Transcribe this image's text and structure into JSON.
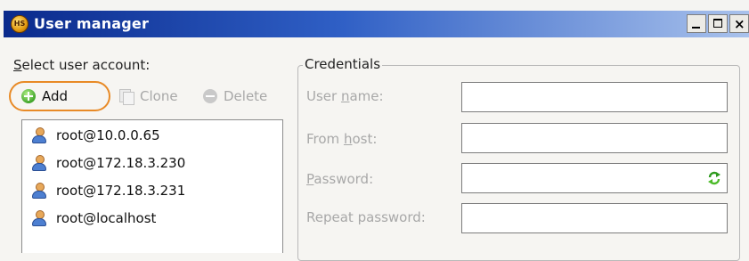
{
  "window": {
    "title": "User manager",
    "app_icon_text": "HS",
    "buttons": [
      "minimize",
      "maximize",
      "close"
    ]
  },
  "users": {
    "label_prefix": "S",
    "label_rest": "elect user account:",
    "toolbar": {
      "add_label": "Add",
      "clone_label": "Clone",
      "delete_label": "Delete"
    },
    "items": [
      "root@10.0.0.65",
      "root@172.18.3.230",
      "root@172.18.3.231",
      "root@localhost"
    ]
  },
  "credentials": {
    "legend": "Credentials",
    "fields": [
      {
        "pre": "User ",
        "ul": "n",
        "post": "ame:",
        "value": ""
      },
      {
        "pre": "From ",
        "ul": "h",
        "post": "ost:",
        "value": ""
      },
      {
        "pre": "",
        "ul": "P",
        "post": "assword:",
        "value": ""
      },
      {
        "pre": "Repeat password:",
        "ul": "",
        "post": "",
        "value": ""
      }
    ]
  },
  "colors": {
    "titlebar_start": "#0a2a8c",
    "titlebar_end": "#a9c2ec",
    "add_highlight": "#e88a26",
    "disabled_text": "#a8a8a8"
  },
  "icons": {
    "add": "add-circle-icon",
    "clone": "clone-icon",
    "delete": "delete-circle-icon",
    "user": "user-icon",
    "password_generate": "refresh-icon"
  }
}
